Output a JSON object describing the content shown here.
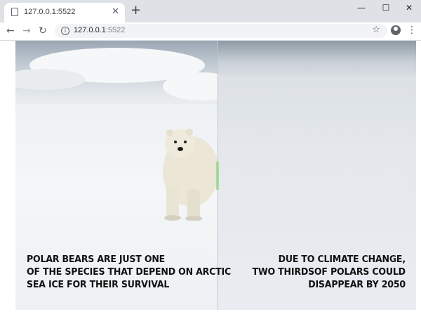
{
  "browser": {
    "tab_title": "127.0.0.1:5522",
    "tab_close": "✕",
    "new_tab": "+",
    "minimize": "—",
    "maximize": "☐",
    "close": "✕",
    "back": "←",
    "forward": "→",
    "reload": "↻",
    "info": "i",
    "url_host": "127.0.0.1",
    "url_port": ":5522",
    "bookmark": "☆",
    "menu": "⋮"
  },
  "slide": {
    "left_caption": [
      "POLAR BEARS ARE JUST ONE",
      "OF THE SPECIES THAT DEPEND ON ARCTIC",
      "SEA ICE FOR THEIR SURVIVAL"
    ],
    "right_caption": [
      "DUE TO CLIMATE CHANGE,",
      "TWO THIRDSOF POLARS COULD",
      "DISAPPEAR BY 2050"
    ]
  }
}
